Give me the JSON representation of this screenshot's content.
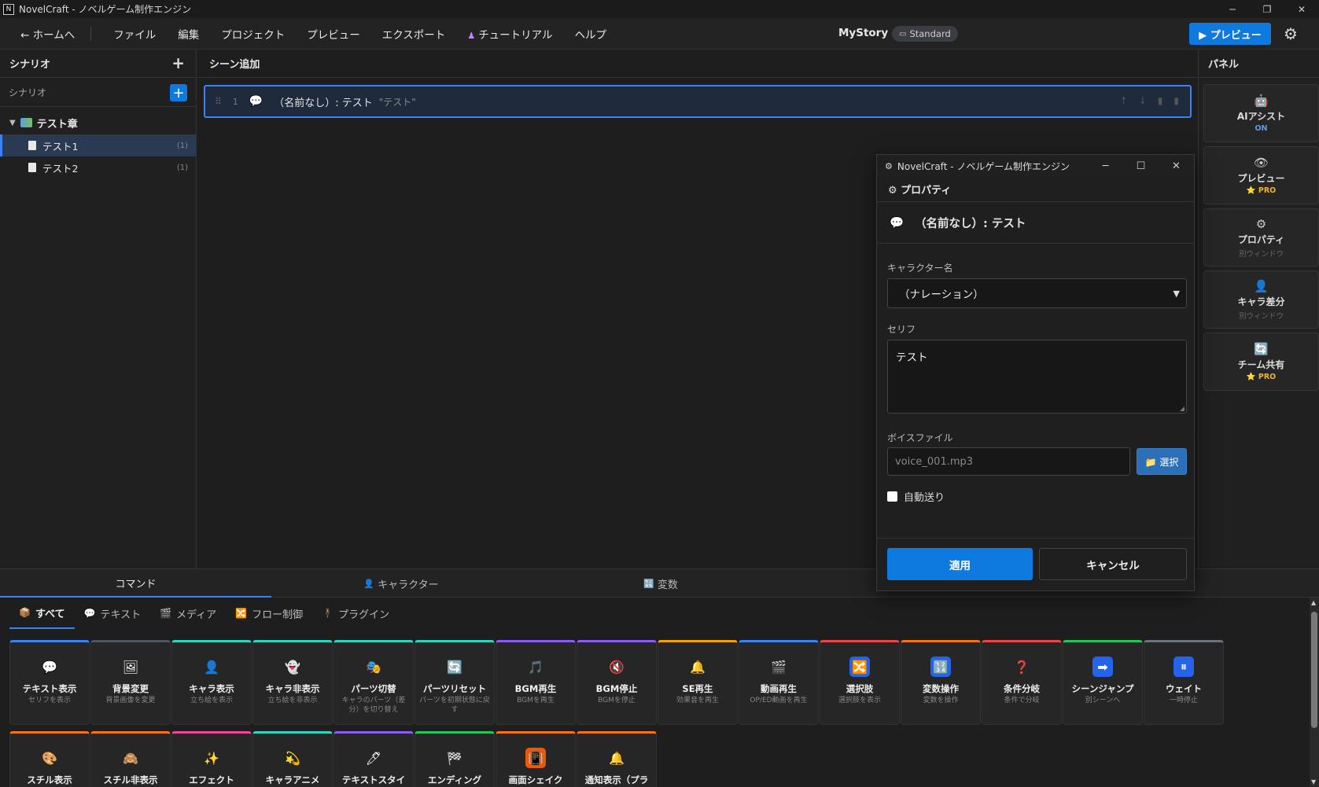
{
  "window": {
    "title": "NovelCraft - ノベルゲーム制作エンジン",
    "minimize": "─",
    "maximize": "❐",
    "close": "✕"
  },
  "menubar": {
    "home": "← ホームへ",
    "items": [
      "ファイル",
      "編集",
      "プロジェクト",
      "プレビュー",
      "エクスポート",
      "チュートリアル",
      "ヘルプ"
    ],
    "tutorial_icon": "♟",
    "project_name": "MyStory",
    "plan_icon": "▭",
    "plan": "Standard",
    "preview_button": "▶ プレビュー",
    "settings_icon": "⚙"
  },
  "left_pane": {
    "title": "シナリオ",
    "add_icon": "+",
    "sub_title": "シナリオ",
    "chapter": "テスト章",
    "scenes": [
      {
        "label": "テスト1",
        "count": "(1)",
        "active": true
      },
      {
        "label": "テスト2",
        "count": "(1)",
        "active": false
      }
    ]
  },
  "center_pane": {
    "title": "シーン追加",
    "command": {
      "grip": "⠿",
      "index": "1",
      "icon": "💬",
      "label": "（名前なし）: テスト",
      "preview": "\"テスト\""
    }
  },
  "right_pane": {
    "title": "パネル",
    "cards": [
      {
        "icon": "🤖",
        "label": "AIアシスト",
        "sub": "ON",
        "kind": "on"
      },
      {
        "icon": "👁",
        "label": "プレビュー",
        "sub": "⭐ PRO",
        "kind": "pro"
      },
      {
        "icon": "⚙",
        "label": "プロパティ",
        "sub": "別ウィンドウ",
        "kind": "plain"
      },
      {
        "icon": "👤",
        "label": "キャラ差分",
        "sub": "別ウィンドウ",
        "kind": "plain"
      },
      {
        "icon": "🔄",
        "label": "チーム共有",
        "sub": "⭐ PRO",
        "kind": "pro"
      }
    ]
  },
  "bottom_tabs": [
    {
      "icon": "",
      "label": "コマンド"
    },
    {
      "icon": "👤",
      "label": "キャラクター"
    },
    {
      "icon": "🔣",
      "label": "変数"
    }
  ],
  "filters": [
    {
      "icon": "📦",
      "label": "すべて"
    },
    {
      "icon": "💬",
      "label": "テキスト"
    },
    {
      "icon": "🎬",
      "label": "メディア"
    },
    {
      "icon": "🔀",
      "label": "フロー制御"
    },
    {
      "icon": "🕴",
      "label": "プラグイン"
    }
  ],
  "commands": [
    {
      "icon": "💬",
      "name": "テキスト表示",
      "desc": "セリフを表示",
      "accent": "#3b82f6",
      "bg": "transparent"
    },
    {
      "icon": "🖼",
      "name": "背景変更",
      "desc": "背景画像を変更",
      "accent": "#4b5563",
      "bg": "transparent"
    },
    {
      "icon": "👤",
      "name": "キャラ表示",
      "desc": "立ち絵を表示",
      "accent": "#2dd4bf",
      "bg": "transparent"
    },
    {
      "icon": "👻",
      "name": "キャラ非表示",
      "desc": "立ち絵を非表示",
      "accent": "#2dd4bf",
      "bg": "transparent"
    },
    {
      "icon": "🎭",
      "name": "パーツ切替",
      "desc": "キャラのパーツ（差分）を切り替え",
      "accent": "#2dd4bf",
      "bg": "transparent"
    },
    {
      "icon": "🔄",
      "name": "パーツリセット",
      "desc": "パーツを初期状態に戻す",
      "accent": "#2dd4bf",
      "bg": "transparent"
    },
    {
      "icon": "🎵",
      "name": "BGM再生",
      "desc": "BGMを再生",
      "accent": "#8b5cf6",
      "bg": "transparent"
    },
    {
      "icon": "🔇",
      "name": "BGM停止",
      "desc": "BGMを停止",
      "accent": "#8b5cf6",
      "bg": "transparent"
    },
    {
      "icon": "🔔",
      "name": "SE再生",
      "desc": "効果音を再生",
      "accent": "#f59e0b",
      "bg": "transparent"
    },
    {
      "icon": "🎬",
      "name": "動画再生",
      "desc": "OP/ED動画を再生",
      "accent": "#3b82f6",
      "bg": "transparent"
    },
    {
      "icon": "🔀",
      "name": "選択肢",
      "desc": "選択肢を表示",
      "accent": "#ef4444",
      "bg": "#2563eb"
    },
    {
      "icon": "🔢",
      "name": "変数操作",
      "desc": "変数を操作",
      "accent": "#f97316",
      "bg": "#2563eb"
    },
    {
      "icon": "❓",
      "name": "条件分岐",
      "desc": "条件で分岐",
      "accent": "#ef4444",
      "bg": "transparent"
    },
    {
      "icon": "➡",
      "name": "シーンジャンプ",
      "desc": "別シーンへ",
      "accent": "#22c55e",
      "bg": "#2563eb"
    },
    {
      "icon": "⏸",
      "name": "ウェイト",
      "desc": "一時停止",
      "accent": "#6b7280",
      "bg": "#2563eb"
    },
    {
      "icon": "🎨",
      "name": "スチル表示",
      "desc": "",
      "accent": "#f97316",
      "bg": "transparent"
    },
    {
      "icon": "🙈",
      "name": "スチル非表示",
      "desc": "",
      "accent": "#f97316",
      "bg": "transparent"
    },
    {
      "icon": "✨",
      "name": "エフェクト",
      "desc": "",
      "accent": "#ec4899",
      "bg": "transparent"
    },
    {
      "icon": "💫",
      "name": "キャラアニメ",
      "desc": "",
      "accent": "#2dd4bf",
      "bg": "transparent"
    },
    {
      "icon": "🖊",
      "name": "テキストスタイ",
      "desc": "",
      "accent": "#8b5cf6",
      "bg": "transparent"
    },
    {
      "icon": "🏁",
      "name": "エンディング",
      "desc": "",
      "accent": "#22c55e",
      "bg": "transparent"
    },
    {
      "icon": "📳",
      "name": "画面シェイク",
      "desc": "",
      "accent": "#f97316",
      "bg": "#ea580c"
    },
    {
      "icon": "🔔",
      "name": "通知表示（プラ",
      "desc": "",
      "accent": "#f97316",
      "bg": "transparent"
    }
  ],
  "dialog": {
    "title": "NovelCraft - ノベルゲーム制作エンジン",
    "section": "⚙ プロパティ",
    "heading_icon": "💬",
    "heading": "（名前なし）: テスト",
    "character_label": "キャラクター名",
    "character_value": "（ナレーション）",
    "line_label": "セリフ",
    "line_value": "テスト",
    "voice_label": "ボイスファイル",
    "voice_placeholder": "voice_001.mp3",
    "pick_button": "📁 選択",
    "auto_advance": "自動送り",
    "apply": "適用",
    "cancel": "キャンセル"
  }
}
